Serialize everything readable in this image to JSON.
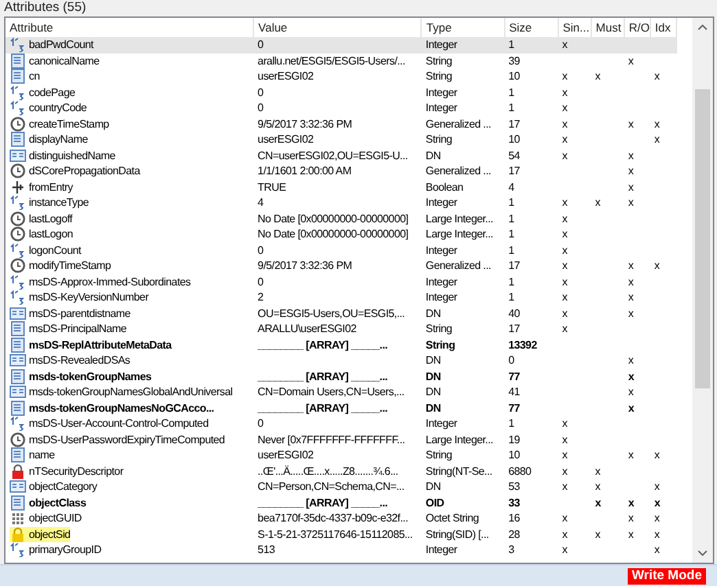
{
  "panel": {
    "title": "Attributes (55)"
  },
  "table": {
    "columns": [
      "Attribute",
      "Value",
      "Type",
      "Size",
      "Sin...",
      "Must",
      "R/O",
      "Idx"
    ],
    "rows": [
      {
        "kind": "integer",
        "name": "badPwdCount",
        "value": "0",
        "type": "Integer",
        "size": "1",
        "sin": "x",
        "selected": true,
        "bold": false,
        "highlighted": false
      },
      {
        "kind": "string",
        "name": "canonicalName",
        "value": "arallu.net/ESGI5/ESGI5-Users/...",
        "type": "String",
        "size": "39",
        "ro": "x",
        "selected": false,
        "bold": false,
        "highlighted": false
      },
      {
        "kind": "string",
        "name": "cn",
        "value": "userESGI02",
        "type": "String",
        "size": "10",
        "sin": "x",
        "must": "x",
        "idx": "x",
        "selected": false,
        "bold": false,
        "highlighted": false
      },
      {
        "kind": "integer",
        "name": "codePage",
        "value": "0",
        "type": "Integer",
        "size": "1",
        "sin": "x",
        "selected": false,
        "bold": false,
        "highlighted": false
      },
      {
        "kind": "integer",
        "name": "countryCode",
        "value": "0",
        "type": "Integer",
        "size": "1",
        "sin": "x",
        "selected": false,
        "bold": false,
        "highlighted": false
      },
      {
        "kind": "time",
        "name": "createTimeStamp",
        "value": "9/5/2017 3:32:36 PM",
        "type": "Generalized ...",
        "size": "17",
        "sin": "x",
        "ro": "x",
        "idx": "x",
        "selected": false,
        "bold": false,
        "highlighted": false
      },
      {
        "kind": "string",
        "name": "displayName",
        "value": "userESGI02",
        "type": "String",
        "size": "10",
        "sin": "x",
        "idx": "x",
        "selected": false,
        "bold": false,
        "highlighted": false
      },
      {
        "kind": "dn",
        "name": "distinguishedName",
        "value": "CN=userESGI02,OU=ESGI5-U...",
        "type": "DN",
        "size": "54",
        "sin": "x",
        "ro": "x",
        "selected": false,
        "bold": false,
        "highlighted": false
      },
      {
        "kind": "time",
        "name": "dSCorePropagationData",
        "value": "1/1/1601 2:00:00 AM",
        "type": "Generalized ...",
        "size": "17",
        "ro": "x",
        "selected": false,
        "bold": false,
        "highlighted": false
      },
      {
        "kind": "boolean",
        "name": "fromEntry",
        "value": "TRUE",
        "type": "Boolean",
        "size": "4",
        "ro": "x",
        "selected": false,
        "bold": false,
        "highlighted": false
      },
      {
        "kind": "integer",
        "name": "instanceType",
        "value": "4",
        "type": "Integer",
        "size": "1",
        "sin": "x",
        "must": "x",
        "ro": "x",
        "selected": false,
        "bold": false,
        "highlighted": false
      },
      {
        "kind": "time",
        "name": "lastLogoff",
        "value": "No Date [0x00000000-00000000]",
        "type": "Large Integer...",
        "size": "1",
        "sin": "x",
        "selected": false,
        "bold": false,
        "highlighted": false
      },
      {
        "kind": "time",
        "name": "lastLogon",
        "value": "No Date [0x00000000-00000000]",
        "type": "Large Integer...",
        "size": "1",
        "sin": "x",
        "selected": false,
        "bold": false,
        "highlighted": false
      },
      {
        "kind": "integer",
        "name": "logonCount",
        "value": "0",
        "type": "Integer",
        "size": "1",
        "sin": "x",
        "selected": false,
        "bold": false,
        "highlighted": false
      },
      {
        "kind": "time",
        "name": "modifyTimeStamp",
        "value": "9/5/2017 3:32:36 PM",
        "type": "Generalized ...",
        "size": "17",
        "sin": "x",
        "ro": "x",
        "idx": "x",
        "selected": false,
        "bold": false,
        "highlighted": false
      },
      {
        "kind": "integer",
        "name": "msDS-Approx-Immed-Subordinates",
        "value": "0",
        "type": "Integer",
        "size": "1",
        "sin": "x",
        "ro": "x",
        "selected": false,
        "bold": false,
        "highlighted": false
      },
      {
        "kind": "integer",
        "name": "msDS-KeyVersionNumber",
        "value": "2",
        "type": "Integer",
        "size": "1",
        "sin": "x",
        "ro": "x",
        "selected": false,
        "bold": false,
        "highlighted": false
      },
      {
        "kind": "dn",
        "name": "msDS-parentdistname",
        "value": "OU=ESGI5-Users,OU=ESGI5,...",
        "type": "DN",
        "size": "40",
        "sin": "x",
        "ro": "x",
        "selected": false,
        "bold": false,
        "highlighted": false
      },
      {
        "kind": "string",
        "name": "msDS-PrincipalName",
        "value": "ARALLU\\userESGI02",
        "type": "String",
        "size": "17",
        "sin": "x",
        "selected": false,
        "bold": false,
        "highlighted": false
      },
      {
        "kind": "string",
        "name": "msDS-ReplAttributeMetaData",
        "value": "________ [ARRAY] _____...",
        "type": "String",
        "size": "13392",
        "selected": false,
        "bold": true,
        "highlighted": false
      },
      {
        "kind": "dn",
        "name": "msDS-RevealedDSAs",
        "type": "DN",
        "size": "0",
        "ro": "x",
        "selected": false,
        "bold": false,
        "highlighted": false
      },
      {
        "kind": "string",
        "name": "msds-tokenGroupNames",
        "value": "________ [ARRAY] _____...",
        "type": "DN",
        "size": "77",
        "ro": "x",
        "selected": false,
        "bold": true,
        "highlighted": false
      },
      {
        "kind": "dn",
        "name": "msds-tokenGroupNamesGlobalAndUniversal",
        "value": "CN=Domain Users,CN=Users,...",
        "type": "DN",
        "size": "41",
        "ro": "x",
        "selected": false,
        "bold": false,
        "highlighted": false
      },
      {
        "kind": "string",
        "name": "msds-tokenGroupNamesNoGCAcco...",
        "value": "________ [ARRAY] _____...",
        "type": "DN",
        "size": "77",
        "ro": "x",
        "selected": false,
        "bold": true,
        "highlighted": false
      },
      {
        "kind": "integer",
        "name": "msDS-User-Account-Control-Computed",
        "value": "0",
        "type": "Integer",
        "size": "1",
        "sin": "x",
        "selected": false,
        "bold": false,
        "highlighted": false
      },
      {
        "kind": "time",
        "name": "msDS-UserPasswordExpiryTimeComputed",
        "value": "Never [0x7FFFFFFF-FFFFFFF...",
        "type": "Large Integer...",
        "size": "19",
        "sin": "x",
        "selected": false,
        "bold": false,
        "highlighted": false
      },
      {
        "kind": "string",
        "name": "name",
        "value": "userESGI02",
        "type": "String",
        "size": "10",
        "sin": "x",
        "ro": "x",
        "idx": "x",
        "selected": false,
        "bold": false,
        "highlighted": false
      },
      {
        "kind": "secured",
        "name": "nTSecurityDescriptor",
        "value": "..Œ'...Ä.....Œ....x.....Z8.......¾.6...",
        "type": "String(NT-Se...",
        "size": "6880",
        "sin": "x",
        "must": "x",
        "selected": false,
        "bold": false,
        "highlighted": false
      },
      {
        "kind": "dn",
        "name": "objectCategory",
        "value": "CN=Person,CN=Schema,CN=...",
        "type": "DN",
        "size": "53",
        "sin": "x",
        "must": "x",
        "idx": "x",
        "selected": false,
        "bold": false,
        "highlighted": false
      },
      {
        "kind": "string",
        "name": "objectClass",
        "value": "________ [ARRAY] _____...",
        "type": "OID",
        "size": "33",
        "must": "x",
        "ro": "x",
        "idx": "x",
        "selected": false,
        "bold": true,
        "highlighted": false
      },
      {
        "kind": "guid",
        "name": "objectGUID",
        "value": "bea7170f-35dc-4337-b09c-e32f...",
        "type": "Octet String",
        "size": "16",
        "sin": "x",
        "ro": "x",
        "idx": "x",
        "selected": false,
        "bold": false,
        "highlighted": false
      },
      {
        "kind": "locked",
        "name": "objectSid",
        "value": "S-1-5-21-3725117646-15112085...",
        "type": "String(SID) [...",
        "size": "28",
        "sin": "x",
        "must": "x",
        "ro": "x",
        "idx": "x",
        "selected": false,
        "bold": false,
        "highlighted": true
      },
      {
        "kind": "integer",
        "name": "primaryGroupID",
        "value": "513",
        "type": "Integer",
        "size": "3",
        "sin": "x",
        "idx": "x",
        "selected": false,
        "bold": false,
        "highlighted": false
      }
    ]
  },
  "status_bar": {
    "mode": "Write Mode"
  }
}
